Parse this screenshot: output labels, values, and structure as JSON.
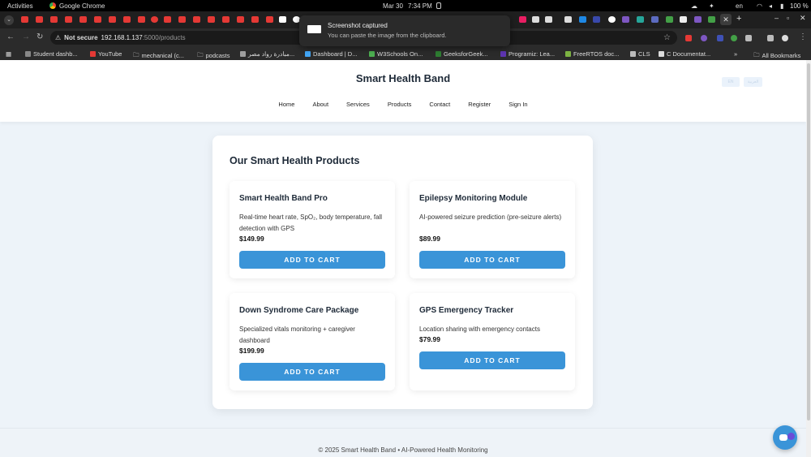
{
  "system_bar": {
    "activities": "Activities",
    "app_name": "Google Chrome",
    "date": "Mar 30",
    "time": "7:34 PM",
    "language": "en",
    "battery": "100 %"
  },
  "browser": {
    "security_label": "Not secure",
    "url_host": "192.168.1.137",
    "url_path": ":5000/products",
    "bookmarks": [
      "Student dashb...",
      "YouTube",
      "mechanical (c...",
      "podcasts",
      "مبادرة رواد مصر...",
      "Dashboard | D...",
      "W3Schools On...",
      "GeeksforGeek...",
      "Programiz: Lea...",
      "FreeRTOS doc...",
      "CLS",
      "C Documentat..."
    ],
    "all_bookmarks": "All Bookmarks"
  },
  "toast": {
    "title": "Screenshot captured",
    "message": "You can paste the image from the clipboard."
  },
  "site": {
    "brand": "Smart Health Band",
    "nav": [
      "Home",
      "About",
      "Services",
      "Products",
      "Contact",
      "Register",
      "Sign In"
    ],
    "lang_buttons": [
      "EN",
      "العربية"
    ],
    "section_title": "Our Smart Health Products",
    "products": [
      {
        "name": "Smart Health Band Pro",
        "description": "Real-time heart rate, SpO₂, body temperature, fall detection with GPS",
        "price": "$149.99",
        "button": "ADD TO CART"
      },
      {
        "name": "Epilepsy Monitoring Module",
        "description": "AI-powered seizure prediction (pre-seizure alerts)",
        "price": "$89.99",
        "button": "ADD TO CART"
      },
      {
        "name": "Down Syndrome Care Package",
        "description": "Specialized vitals monitoring + caregiver dashboard",
        "price": "$199.99",
        "button": "ADD TO CART"
      },
      {
        "name": "GPS Emergency Tracker",
        "description": "Location sharing with emergency contacts",
        "price": "$79.99",
        "button": "ADD TO CART"
      }
    ],
    "footer": "© 2025 Smart Health Band • AI-Powered Health Monitoring"
  },
  "colors": {
    "accent": "#3a94d8",
    "heading": "#1e2a38",
    "page_bg": "#edf3f9"
  }
}
